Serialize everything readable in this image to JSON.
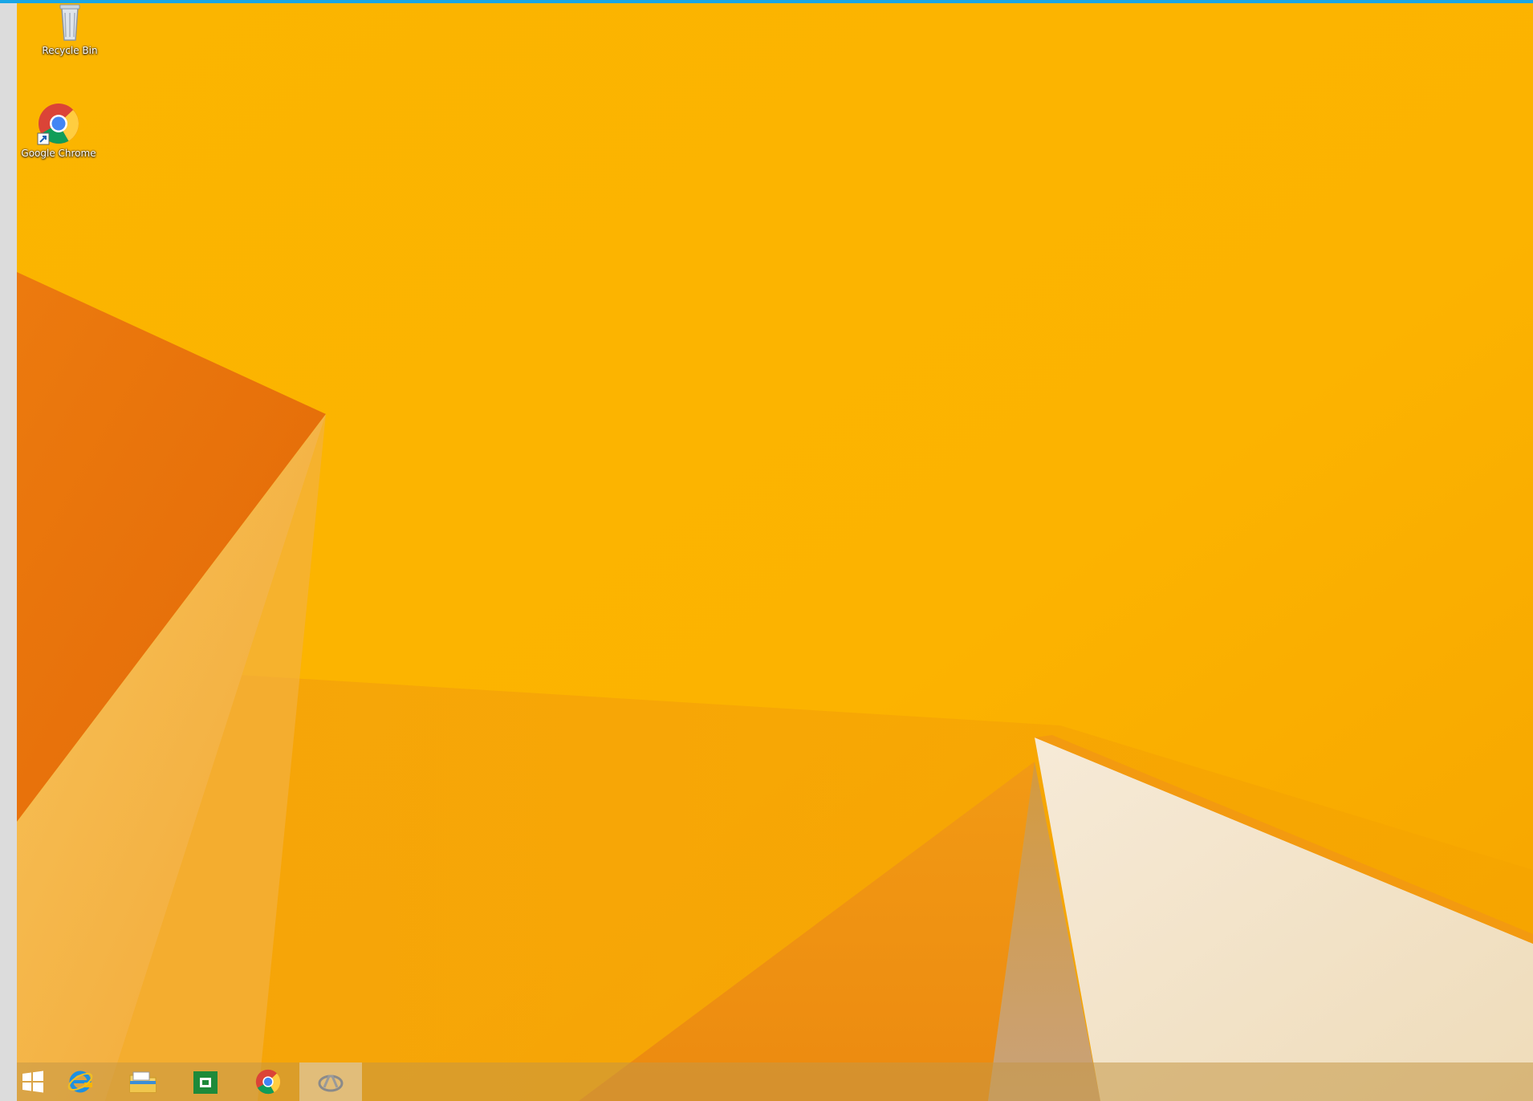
{
  "desktop": {
    "icons": [
      {
        "label": "Recycle Bin",
        "icon": "recycle-bin-icon"
      },
      {
        "label": "Google Chrome",
        "icon": "chrome-icon"
      }
    ]
  },
  "taskbar": {
    "buttons": [
      {
        "name": "start-button",
        "icon": "windows-logo-icon"
      },
      {
        "name": "internet-explorer-button",
        "icon": "internet-explorer-icon"
      },
      {
        "name": "file-explorer-button",
        "icon": "file-explorer-icon"
      },
      {
        "name": "store-button",
        "icon": "store-icon"
      },
      {
        "name": "chrome-taskbar-button",
        "icon": "chrome-icon"
      },
      {
        "name": "active-app-button",
        "icon": "app-icon",
        "active": true
      }
    ]
  },
  "colors": {
    "frame_top": "#18a6e6",
    "frame_left": "#dcdcdc",
    "wallpaper_primary": "#fbb400",
    "wallpaper_orange": "#ee7d0e",
    "wallpaper_cream": "#f2e2c4",
    "taskbar": "#c49846"
  }
}
